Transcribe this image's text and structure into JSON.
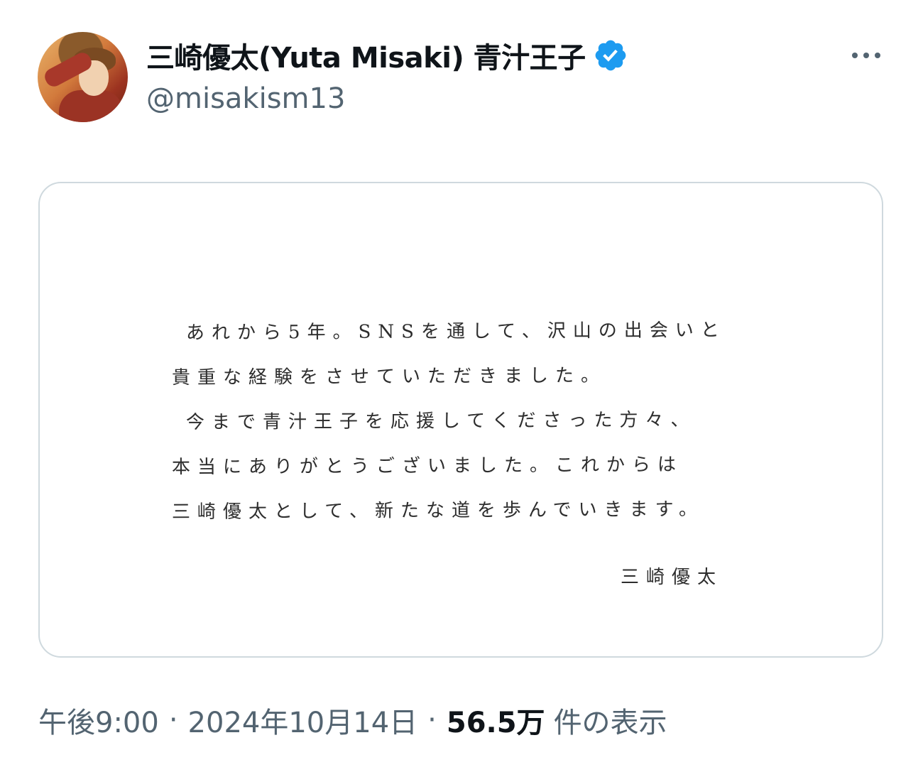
{
  "author": {
    "display_name": "三崎優太(Yuta Misaki) 青汁王子",
    "handle": "@misakism13",
    "avatar_icon": "profile-photo",
    "verified_icon": "verified-badge-icon",
    "verified_color": "#1d9bf0"
  },
  "more_icon": "more-horizontal-icon",
  "letter": {
    "lines": [
      "あれから5年。SNSを通して、沢山の出会いと",
      "貴重な経験をさせていただきました。",
      "今まで青汁王子を応援してくださった方々、",
      "本当にありがとうございました。これからは",
      "三崎優太として、新たな道を歩んでいきます。"
    ],
    "signature": "三崎優太"
  },
  "meta": {
    "time": "午後9:00",
    "separator": "·",
    "date": "2024年10月14日",
    "views_count": "56.5万",
    "views_label": "件の表示"
  },
  "colors": {
    "text_primary": "#0f1419",
    "text_secondary": "#536471",
    "border": "#cfd9de"
  }
}
